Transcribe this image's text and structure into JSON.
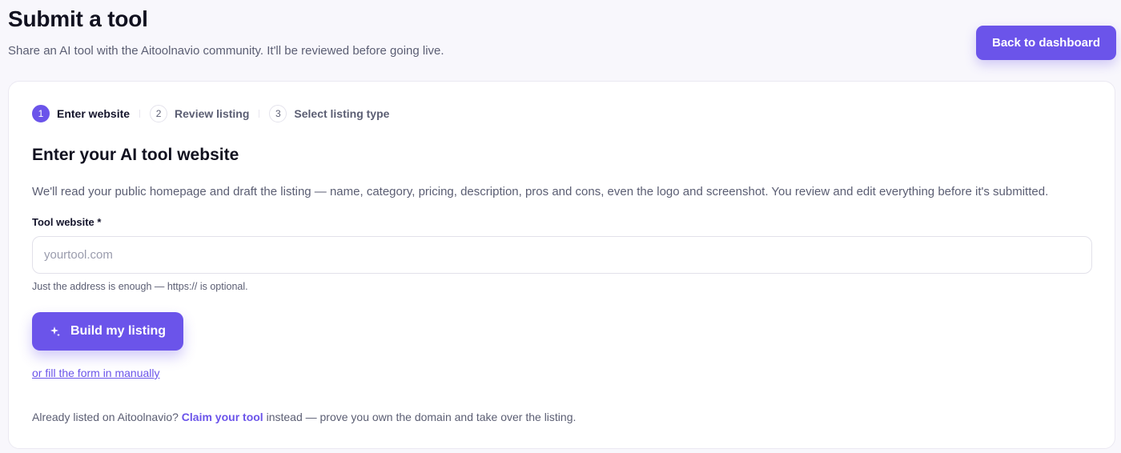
{
  "header": {
    "title": "Submit a tool",
    "subtitle": "Share an AI tool with the Aitoolnavio community. It'll be reviewed before going live.",
    "back_button_label": "Back to dashboard"
  },
  "stepper": {
    "steps": [
      {
        "number": "1",
        "label": "Enter website",
        "active": true
      },
      {
        "number": "2",
        "label": "Review listing",
        "active": false
      },
      {
        "number": "3",
        "label": "Select listing type",
        "active": false
      }
    ]
  },
  "form": {
    "title": "Enter your AI tool website",
    "description": "We'll read your public homepage and draft the listing — name, category, pricing, description, pros and cons, even the logo and screenshot. You review and edit everything before it's submitted.",
    "field_label": "Tool website *",
    "input_placeholder": "yourtool.com",
    "input_value": "",
    "hint": "Just the address is enough — https:// is optional.",
    "build_button_label": "Build my listing",
    "build_button_icon": "sparkle-icon",
    "manual_link": "or fill the form in manually"
  },
  "claim": {
    "prefix": "Already listed on Aitoolnavio? ",
    "link_label": "Claim your tool",
    "suffix": " instead — prove you own the domain and take over the listing."
  },
  "colors": {
    "accent": "#6b54ea",
    "background": "#f8f7fc",
    "card": "#ffffff",
    "text_primary": "#11111f",
    "text_secondary": "#5b5e73"
  }
}
